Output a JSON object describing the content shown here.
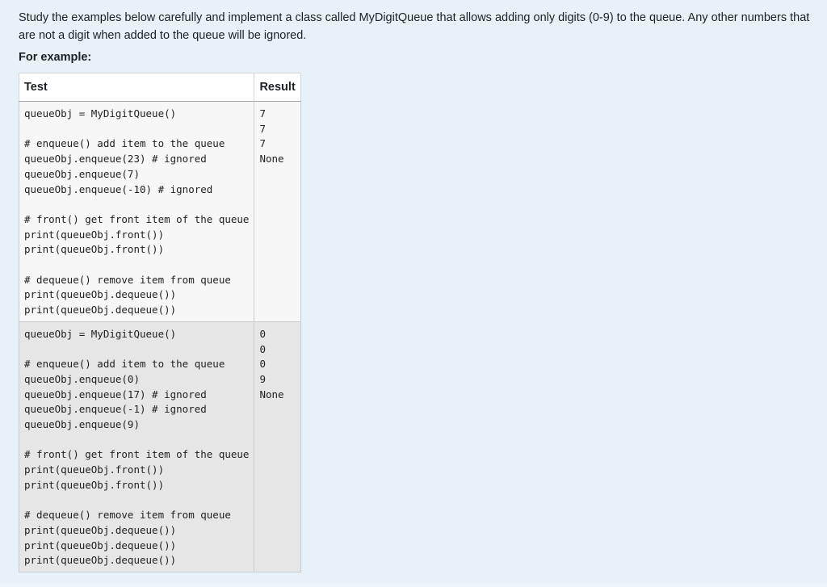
{
  "question": {
    "text": "Study the examples below carefully and implement a class called MyDigitQueue that allows adding only digits (0-9) to the queue. Any other numbers that are not a digit when added to the queue will be ignored.",
    "example_label": "For example:"
  },
  "table": {
    "headers": [
      "Test",
      "Result"
    ],
    "rows": [
      {
        "test": "queueObj = MyDigitQueue()\n\n# enqueue() add item to the queue\nqueueObj.enqueue(23) # ignored\nqueueObj.enqueue(7)\nqueueObj.enqueue(-10) # ignored\n\n# front() get front item of the queue\nprint(queueObj.front())\nprint(queueObj.front())\n\n# dequeue() remove item from queue\nprint(queueObj.dequeue())\nprint(queueObj.dequeue())",
        "result": "7\n7\n7\nNone"
      },
      {
        "test": "queueObj = MyDigitQueue()\n\n# enqueue() add item to the queue\nqueueObj.enqueue(0)\nqueueObj.enqueue(17) # ignored\nqueueObj.enqueue(-1) # ignored\nqueueObj.enqueue(9)\n\n# front() get front item of the queue\nprint(queueObj.front())\nprint(queueObj.front())\n\n# dequeue() remove item from queue\nprint(queueObj.dequeue())\nprint(queueObj.dequeue())\nprint(queueObj.dequeue())",
        "result": "0\n0\n0\n9\nNone"
      }
    ]
  }
}
